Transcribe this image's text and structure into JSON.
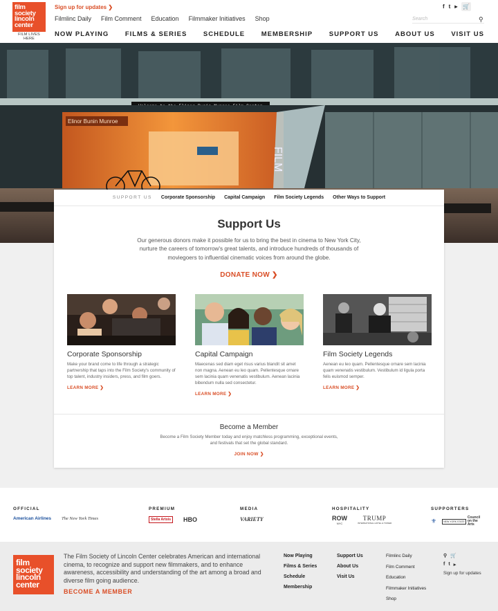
{
  "brand": {
    "logo_lines": [
      "film",
      "society",
      "lincoln",
      "center"
    ],
    "tagline": "FILM LIVES HERE",
    "accent": "#e8502a",
    "link_color": "#d94d25"
  },
  "header": {
    "signup_label": "Sign up for updates",
    "subnav": [
      "Filmlinc Daily",
      "Film Comment",
      "Education",
      "Filmmaker Initiatives",
      "Shop"
    ],
    "search_placeholder": "Search",
    "social": {
      "facebook": "f",
      "twitter": "t",
      "youtube": "▸"
    },
    "cart_icon": "cart-icon"
  },
  "main_nav": [
    "NOW PLAYING",
    "FILMS & SERIES",
    "SCHEDULE",
    "MEMBERSHIP",
    "SUPPORT US",
    "ABOUT US",
    "VISIT US"
  ],
  "hero": {
    "marquee": "Welcome to the Elinor Bunin Munroe Film Center",
    "sign": "Elinor Bunin Munroe",
    "building_text": "FILM"
  },
  "support_tabs": {
    "label": "SUPPORT US",
    "items": [
      "Corporate Sponsorship",
      "Capital Campaign",
      "Film Society Legends",
      "Other Ways to Support"
    ]
  },
  "support": {
    "title": "Support Us",
    "intro": "Our generous donors make it possible for us to bring the best in cinema to New York City, nurture the careers of tomorrow's great talents, and introduce hundreds of thousands of moviegoers to influential cinematic voices from around the globe.",
    "donate_label": "DONATE NOW",
    "features": [
      {
        "title": "Corporate Sponsorship",
        "text": "Make your brand come to life through a strategic partnership that taps into the Film Society's community of top talent, industry insiders, press, and film goers.",
        "more": "LEARN MORE"
      },
      {
        "title": "Capital Campaign",
        "text": "Maecenas sed diam eget risus varius blandit sit amet non magna. Aenean eu leo quam. Pellentesque ornare sem lacinia quam venenatis vestibulum. Aenean lacinia bibendum nulla sed consectetur.",
        "more": "LEARN MORE"
      },
      {
        "title": "Film Society Legends",
        "text": "Aenean eu leo quam. Pellentesque ornare sem lacinia quam venenatis vestibulum. Vestibulum id ligula porta felis euismod semper.",
        "more": "LEARN MORE"
      }
    ],
    "member": {
      "title": "Become a Member",
      "text": "Become a Film Society Member today and enjoy matchless programming, exceptional events, and festivals that set the global standard.",
      "join": "JOIN NOW"
    }
  },
  "sponsors": {
    "official": {
      "label": "OFFICIAL",
      "logos": [
        "American Airlines",
        "The New York Times"
      ]
    },
    "premium": {
      "label": "PREMIUM",
      "logos": [
        "Stella Artois",
        "HBO"
      ]
    },
    "media": {
      "label": "MEDIA",
      "logos": [
        "VARIETY"
      ]
    },
    "hospitality": {
      "label": "HOSPITALITY",
      "logos": [
        "ROW",
        "NYC",
        "TRUMP",
        "INTERNATIONAL HOTEL & TOWER"
      ]
    },
    "supporters": {
      "label": "SUPPORTERS",
      "logos": [
        "NEW YORK STATE",
        "Council on the Arts"
      ]
    }
  },
  "footer": {
    "logo_lines": [
      "film",
      "society",
      "lincoln",
      "center"
    ],
    "about": "The Film Society of Lincoln Center celebrates American and international cinema, to recognize and support new filmmakers, and to enhance awareness, accessibility and understanding of the art among a broad and diverse film going audience.",
    "become_label": "BECOME A MEMBER",
    "col1": [
      "Now Playing",
      "Films & Series",
      "Schedule",
      "Membership"
    ],
    "col2": [
      "Support Us",
      "About Us",
      "Visit Us"
    ],
    "col3": [
      "Filmlinc Daily",
      "Film Comment",
      "Education",
      "Filmmaker Initiatives",
      "Shop"
    ],
    "signup_label": "Sign up for updates"
  }
}
